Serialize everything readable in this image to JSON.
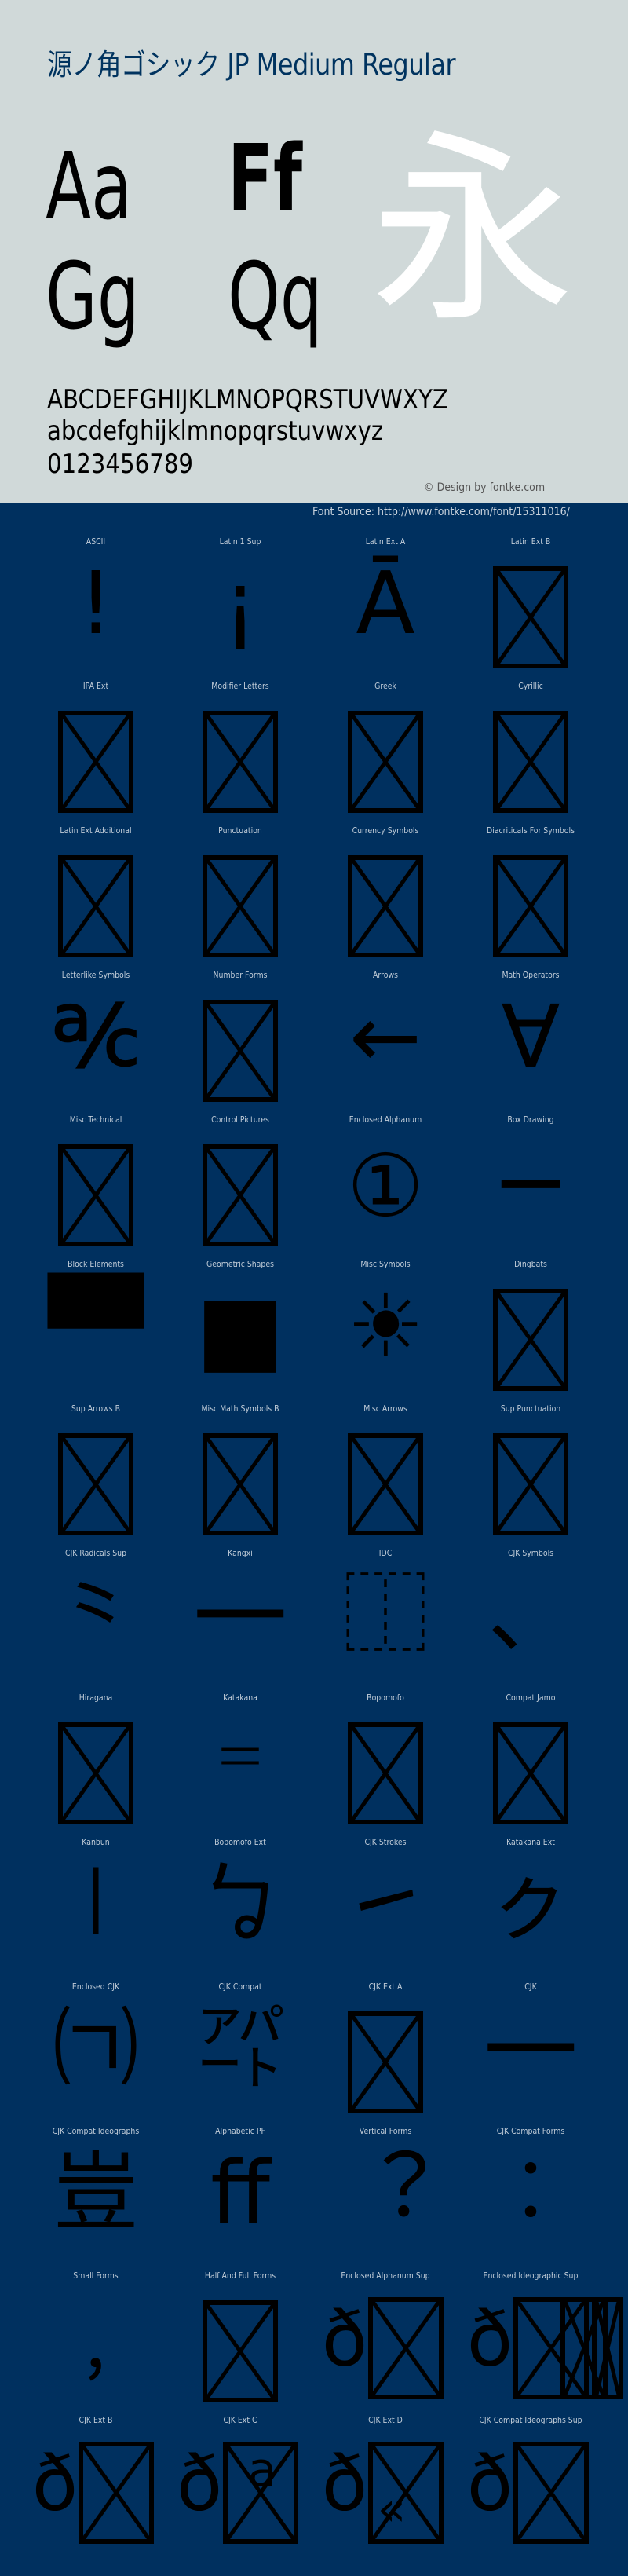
{
  "header": {
    "title": "源ノ角ゴシック JP Medium Regular",
    "sample_pairs": [
      "Aa",
      "Ff",
      "Gg",
      "Qq"
    ],
    "sample_kanji": "永",
    "uppercase": "ABCDEFGHIJKLMNOPQRSTUVWXYZ",
    "lowercase": "abcdefghijklmnopqrstuvwxyz",
    "digits": "0123456789",
    "copyright": "© Design by fontke.com"
  },
  "source": "Font Source: http://www.fontke.com/font/15311016/",
  "colors": {
    "header_bg": "#d0d9d9",
    "title": "#00335f",
    "body_bg": "#00305f",
    "kanji": "#ffffff",
    "glyph": "#000000"
  },
  "blocks": [
    {
      "label": "ASCII",
      "glyph": "!"
    },
    {
      "label": "Latin 1 Sup",
      "glyph": "¡"
    },
    {
      "label": "Latin Ext A",
      "glyph": "Ā"
    },
    {
      "label": "Latin Ext B",
      "glyph": "missing-glyph"
    },
    {
      "label": "IPA Ext",
      "glyph": "missing-glyph"
    },
    {
      "label": "Modifier Letters",
      "glyph": "missing-glyph"
    },
    {
      "label": "Greek",
      "glyph": "missing-glyph"
    },
    {
      "label": "Cyrillic",
      "glyph": "missing-glyph"
    },
    {
      "label": "Latin Ext Additional",
      "glyph": "missing-glyph"
    },
    {
      "label": "Punctuation",
      "glyph": "missing-glyph"
    },
    {
      "label": "Currency Symbols",
      "glyph": "missing-glyph"
    },
    {
      "label": "Diacriticals For Symbols",
      "glyph": "missing-glyph"
    },
    {
      "label": "Letterlike Symbols",
      "glyph": "℀"
    },
    {
      "label": "Number Forms",
      "glyph": "missing-glyph"
    },
    {
      "label": "Arrows",
      "glyph": "←"
    },
    {
      "label": "Math Operators",
      "glyph": "∀"
    },
    {
      "label": "Misc Technical",
      "glyph": "missing-glyph"
    },
    {
      "label": "Control Pictures",
      "glyph": "missing-glyph"
    },
    {
      "label": "Enclosed Alphanum",
      "glyph": "①"
    },
    {
      "label": "Box Drawing",
      "glyph": "─"
    },
    {
      "label": "Block Elements",
      "glyph": "▀"
    },
    {
      "label": "Geometric Shapes",
      "glyph": "■"
    },
    {
      "label": "Misc Symbols",
      "glyph": "☀"
    },
    {
      "label": "Dingbats",
      "glyph": "missing-glyph"
    },
    {
      "label": "Sup Arrows B",
      "glyph": "missing-glyph"
    },
    {
      "label": "Misc Math Symbols B",
      "glyph": "missing-glyph"
    },
    {
      "label": "Misc Arrows",
      "glyph": "missing-glyph"
    },
    {
      "label": "Sup Punctuation",
      "glyph": "missing-glyph"
    },
    {
      "label": "CJK Radicals Sup",
      "glyph": "⺀"
    },
    {
      "label": "Kangxi",
      "glyph": "⼀"
    },
    {
      "label": "IDC",
      "glyph": "⿰"
    },
    {
      "label": "CJK Symbols",
      "glyph": "、"
    },
    {
      "label": "Hiragana",
      "glyph": "missing-glyph"
    },
    {
      "label": "Katakana",
      "glyph": "゠"
    },
    {
      "label": "Bopomofo",
      "glyph": "missing-glyph"
    },
    {
      "label": "Compat Jamo",
      "glyph": "missing-glyph"
    },
    {
      "label": "Kanbun",
      "glyph": "㆐"
    },
    {
      "label": "Bopomofo Ext",
      "glyph": "ㆠ"
    },
    {
      "label": "CJK Strokes",
      "glyph": "㇀"
    },
    {
      "label": "Katakana Ext",
      "glyph": "ㇰ"
    },
    {
      "label": "Enclosed CJK",
      "glyph": "㈀"
    },
    {
      "label": "CJK Compat",
      "glyph": "㌀"
    },
    {
      "label": "CJK Ext A",
      "glyph": "missing-glyph"
    },
    {
      "label": "CJK",
      "glyph": "一"
    },
    {
      "label": "CJK Compat Ideographs",
      "glyph": "豈"
    },
    {
      "label": "Alphabetic PF",
      "glyph": "ﬀ"
    },
    {
      "label": "Vertical Forms",
      "glyph": "︖"
    },
    {
      "label": "CJK Compat Forms",
      "glyph": "︰"
    },
    {
      "label": "Small Forms",
      "glyph": "﹐"
    },
    {
      "label": "Half And Full Forms",
      "glyph": "missing-glyph"
    },
    {
      "label": "Enclosed Alphanum Sup",
      "glyph": "ð missing-glyph"
    },
    {
      "label": "Enclosed Ideographic Sup",
      "glyph": "ð missing-glyph ×3"
    },
    {
      "label": "CJK Ext B",
      "glyph": "ð missing-glyph"
    },
    {
      "label": "CJK Ext C",
      "glyph": "ð missing-glyph a"
    },
    {
      "label": "CJK Ext D",
      "glyph": "ð missing-glyph «"
    },
    {
      "label": "CJK Compat Ideographs Sup",
      "glyph": "ð missing-glyph ¯"
    }
  ]
}
